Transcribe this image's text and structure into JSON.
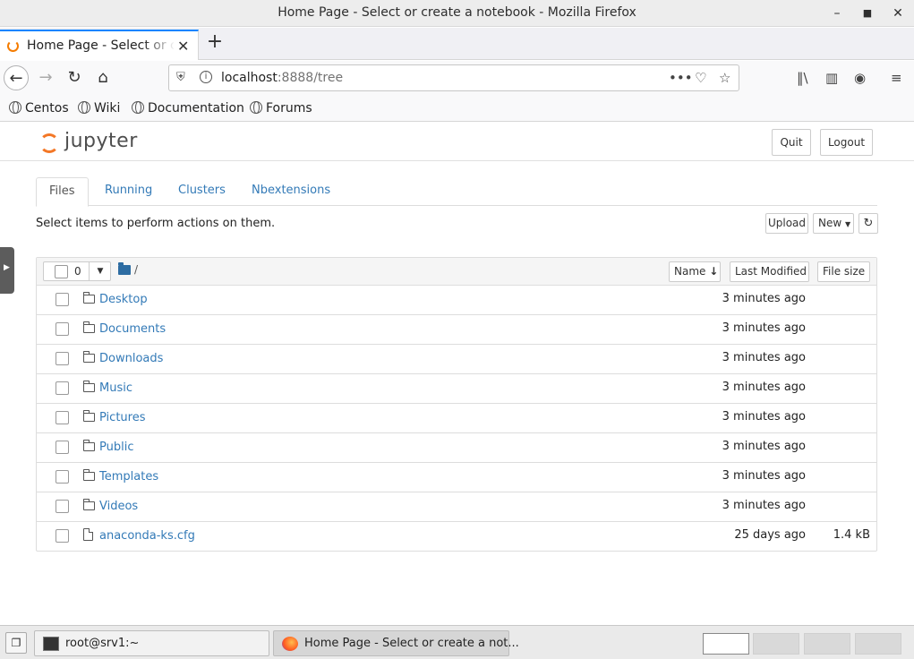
{
  "window": {
    "title": "Home Page - Select or create a notebook - Mozilla Firefox"
  },
  "browser": {
    "tab_title": "Home Page - Select or create a notebook",
    "url_host": "localhost",
    "url_rest": ":8888/tree",
    "bookmarks": [
      "Centos",
      "Wiki",
      "Documentation",
      "Forums"
    ]
  },
  "jupyter": {
    "logo_text": "jupyter",
    "quit_label": "Quit",
    "logout_label": "Logout",
    "tabs": [
      "Files",
      "Running",
      "Clusters",
      "Nbextensions"
    ],
    "hint": "Select items to perform actions on them.",
    "upload_label": "Upload",
    "new_label": "New",
    "selected_count": "0",
    "breadcrumb": "/",
    "columns": {
      "name": "Name",
      "last_modified": "Last Modified",
      "file_size": "File size"
    },
    "files": [
      {
        "name": "Desktop",
        "type": "folder",
        "modified": "3 minutes ago",
        "size": ""
      },
      {
        "name": "Documents",
        "type": "folder",
        "modified": "3 minutes ago",
        "size": ""
      },
      {
        "name": "Downloads",
        "type": "folder",
        "modified": "3 minutes ago",
        "size": ""
      },
      {
        "name": "Music",
        "type": "folder",
        "modified": "3 minutes ago",
        "size": ""
      },
      {
        "name": "Pictures",
        "type": "folder",
        "modified": "3 minutes ago",
        "size": ""
      },
      {
        "name": "Public",
        "type": "folder",
        "modified": "3 minutes ago",
        "size": ""
      },
      {
        "name": "Templates",
        "type": "folder",
        "modified": "3 minutes ago",
        "size": ""
      },
      {
        "name": "Videos",
        "type": "folder",
        "modified": "3 minutes ago",
        "size": ""
      },
      {
        "name": "anaconda-ks.cfg",
        "type": "file",
        "modified": "25 days ago",
        "size": "1.4 kB"
      }
    ]
  },
  "taskbar": {
    "items": [
      {
        "label": "root@srv1:~",
        "icon": "terminal-icon"
      },
      {
        "label": "Home Page - Select or create a not...",
        "icon": "firefox-icon"
      }
    ]
  },
  "colors": {
    "link": "#337ab7",
    "accent": "#0a84ff",
    "jupyter_orange": "#f37726"
  }
}
